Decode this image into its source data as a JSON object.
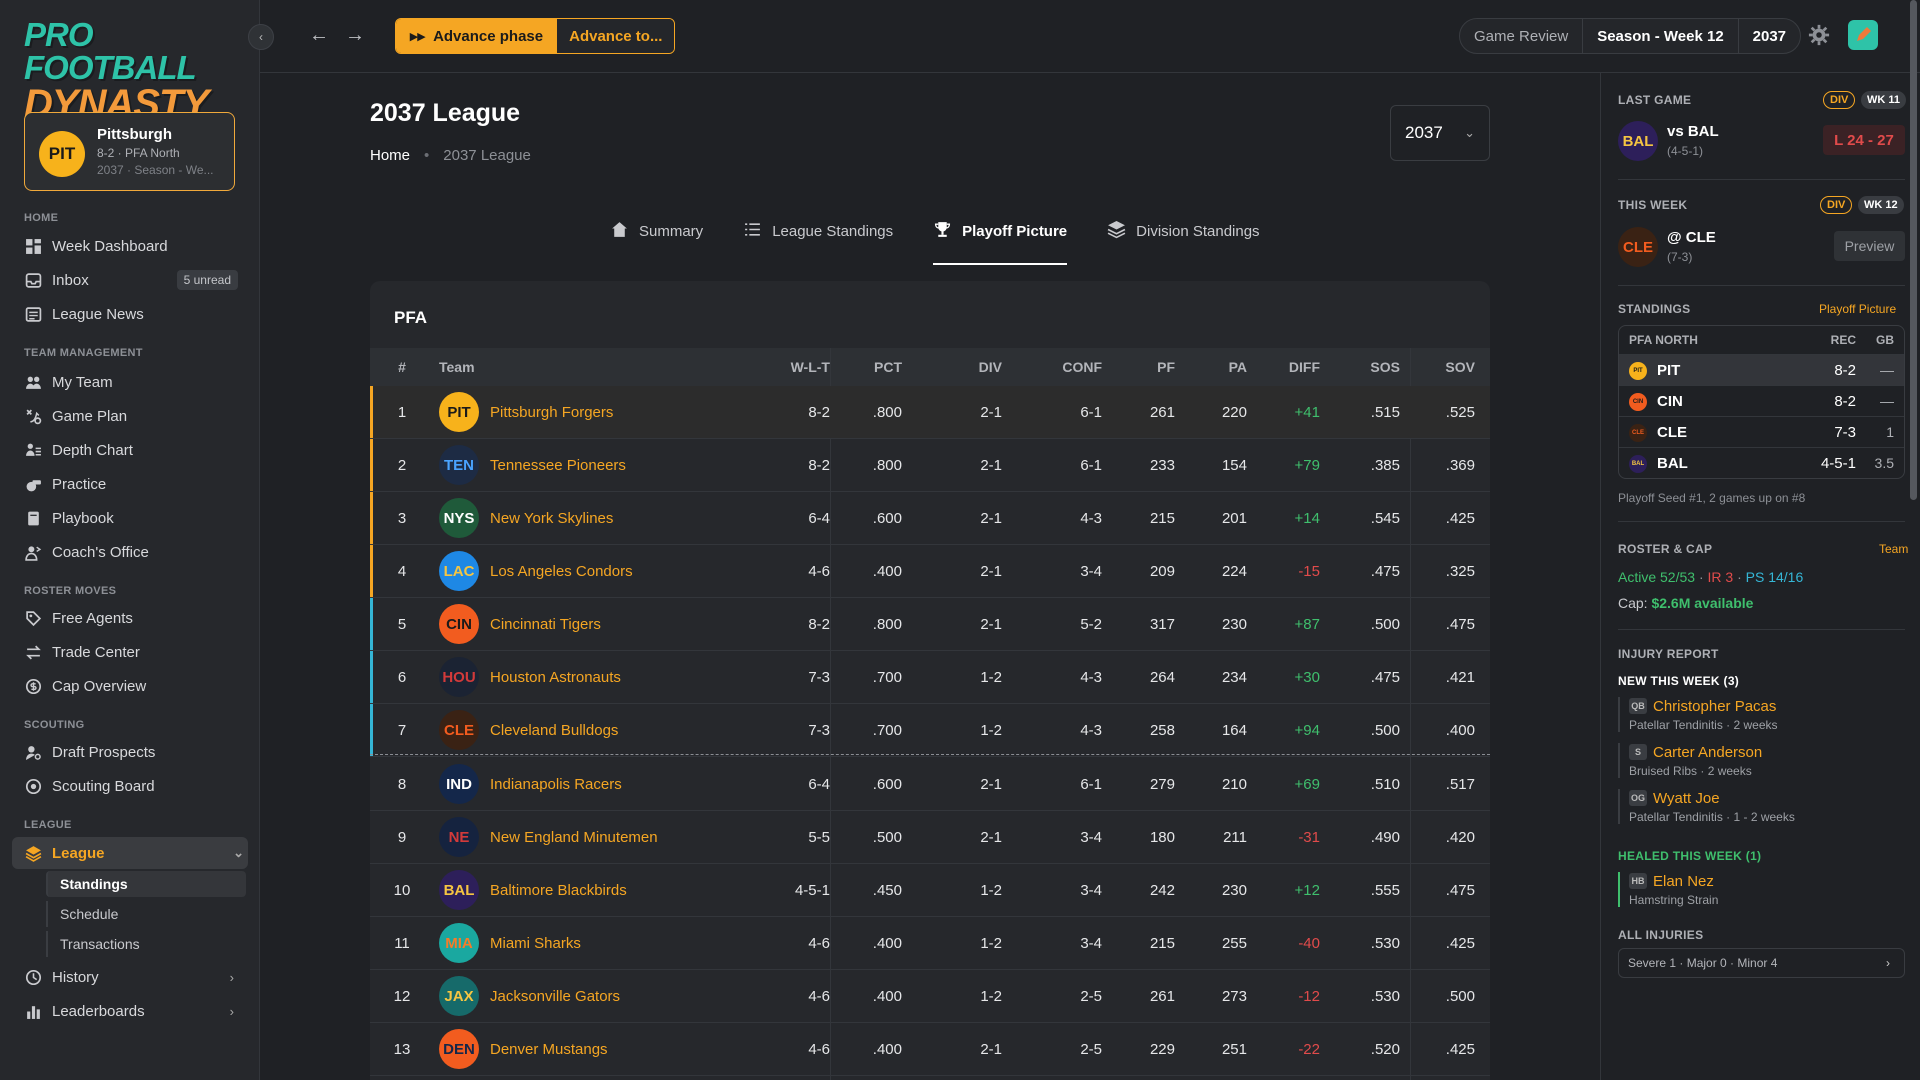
{
  "app": {
    "logo_line1": "PRO FOOTBALL",
    "logo_line2": "DYNASTY",
    "collapse_glyph": "‹",
    "accent": "#f5a623"
  },
  "team_card": {
    "abbr": "PIT",
    "name": "Pittsburgh",
    "record_line": "8-2 · PFA North",
    "season_line": "2037 · Season - We..."
  },
  "sidebar": {
    "sections": {
      "home": "HOME",
      "team_management": "TEAM MANAGEMENT",
      "roster_moves": "ROSTER MOVES",
      "scouting": "SCOUTING",
      "league": "LEAGUE"
    },
    "items": {
      "week_dashboard": "Week Dashboard",
      "inbox": "Inbox",
      "inbox_count": "5 unread",
      "league_news": "League News",
      "my_team": "My Team",
      "game_plan": "Game Plan",
      "depth_chart": "Depth Chart",
      "practice": "Practice",
      "playbook": "Playbook",
      "coachs_office": "Coach's Office",
      "free_agents": "Free Agents",
      "trade_center": "Trade Center",
      "cap_overview": "Cap Overview",
      "draft_prospects": "Draft Prospects",
      "scouting_board": "Scouting Board",
      "league": "League",
      "standings": "Standings",
      "schedule": "Schedule",
      "transactions": "Transactions",
      "history": "History",
      "leaderboards": "Leaderboards"
    }
  },
  "topbar": {
    "back": "←",
    "forward": "→",
    "advance_phase": "Advance phase",
    "advance_to": "Advance to...",
    "game_review": "Game Review",
    "season_week": "Season - Week 12",
    "year": "2037"
  },
  "page": {
    "title": "2037 League",
    "crumb_home": "Home",
    "crumb_sep": "•",
    "crumb_current": "2037 League",
    "year_select": "2037",
    "tabs": {
      "summary": "Summary",
      "league_standings": "League Standings",
      "playoff_picture": "Playoff Picture",
      "division_standings": "Division Standings"
    }
  },
  "table": {
    "conference": "PFA",
    "headers": {
      "rank": "#",
      "team": "Team",
      "wlt": "W-L-T",
      "pct": "PCT",
      "div": "DIV",
      "conf": "CONF",
      "pf": "PF",
      "pa": "PA",
      "diff": "DIFF",
      "sos": "SOS",
      "sov": "SOV"
    },
    "rows": [
      {
        "rank": "1",
        "abbr": "PIT",
        "name": "Pittsburgh Forgers",
        "wlt": "8-2",
        "pct": ".800",
        "div": "2-1",
        "conf": "6-1",
        "pf": "261",
        "pa": "220",
        "diff": "+41",
        "sos": ".515",
        "sov": ".525",
        "logo_bg": "#f7b21b",
        "logo_fg": "#1a1a1a",
        "seed": "division"
      },
      {
        "rank": "2",
        "abbr": "TEN",
        "name": "Tennessee Pioneers",
        "wlt": "8-2",
        "pct": ".800",
        "div": "2-1",
        "conf": "6-1",
        "pf": "233",
        "pa": "154",
        "diff": "+79",
        "sos": ".385",
        "sov": ".369",
        "logo_bg": "#1d2b44",
        "logo_fg": "#4aa3ff",
        "seed": "division"
      },
      {
        "rank": "3",
        "abbr": "NYS",
        "name": "New York Skylines",
        "wlt": "6-4",
        "pct": ".600",
        "div": "2-1",
        "conf": "4-3",
        "pf": "215",
        "pa": "201",
        "diff": "+14",
        "sos": ".545",
        "sov": ".425",
        "logo_bg": "#1f5a3a",
        "logo_fg": "#ffffff",
        "seed": "division"
      },
      {
        "rank": "4",
        "abbr": "LAC",
        "name": "Los Angeles Condors",
        "wlt": "4-6",
        "pct": ".400",
        "div": "2-1",
        "conf": "3-4",
        "pf": "209",
        "pa": "224",
        "diff": "-15",
        "sos": ".475",
        "sov": ".325",
        "logo_bg": "#1e88e5",
        "logo_fg": "#f5c542",
        "seed": "division"
      },
      {
        "rank": "5",
        "abbr": "CIN",
        "name": "Cincinnati Tigers",
        "wlt": "8-2",
        "pct": ".800",
        "div": "2-1",
        "conf": "5-2",
        "pf": "317",
        "pa": "230",
        "diff": "+87",
        "sos": ".500",
        "sov": ".475",
        "logo_bg": "#f25c1f",
        "logo_fg": "#1a1a1a",
        "seed": "wildcard"
      },
      {
        "rank": "6",
        "abbr": "HOU",
        "name": "Houston Astronauts",
        "wlt": "7-3",
        "pct": ".700",
        "div": "1-2",
        "conf": "4-3",
        "pf": "264",
        "pa": "234",
        "diff": "+30",
        "sos": ".475",
        "sov": ".421",
        "logo_bg": "#1b2333",
        "logo_fg": "#d33a3a",
        "seed": "wildcard"
      },
      {
        "rank": "7",
        "abbr": "CLE",
        "name": "Cleveland Bulldogs",
        "wlt": "7-3",
        "pct": ".700",
        "div": "1-2",
        "conf": "4-3",
        "pf": "258",
        "pa": "164",
        "diff": "+94",
        "sos": ".500",
        "sov": ".400",
        "logo_bg": "#3a2214",
        "logo_fg": "#f25c1f",
        "seed": "wildcard"
      },
      {
        "rank": "8",
        "abbr": "IND",
        "name": "Indianapolis Racers",
        "wlt": "6-4",
        "pct": ".600",
        "div": "2-1",
        "conf": "6-1",
        "pf": "279",
        "pa": "210",
        "diff": "+69",
        "sos": ".510",
        "sov": ".517",
        "logo_bg": "#14274a",
        "logo_fg": "#ffffff",
        "seed": "none"
      },
      {
        "rank": "9",
        "abbr": "NE",
        "name": "New England Minutemen",
        "wlt": "5-5",
        "pct": ".500",
        "div": "2-1",
        "conf": "3-4",
        "pf": "180",
        "pa": "211",
        "diff": "-31",
        "sos": ".490",
        "sov": ".420",
        "logo_bg": "#15233f",
        "logo_fg": "#d33a3a",
        "seed": "none"
      },
      {
        "rank": "10",
        "abbr": "BAL",
        "name": "Baltimore Blackbirds",
        "wlt": "4-5-1",
        "pct": ".450",
        "div": "1-2",
        "conf": "3-4",
        "pf": "242",
        "pa": "230",
        "diff": "+12",
        "sos": ".555",
        "sov": ".475",
        "logo_bg": "#2d1f5a",
        "logo_fg": "#f5c542",
        "seed": "none"
      },
      {
        "rank": "11",
        "abbr": "MIA",
        "name": "Miami Sharks",
        "wlt": "4-6",
        "pct": ".400",
        "div": "1-2",
        "conf": "3-4",
        "pf": "215",
        "pa": "255",
        "diff": "-40",
        "sos": ".530",
        "sov": ".425",
        "logo_bg": "#1aa8a0",
        "logo_fg": "#f57c2a",
        "seed": "none"
      },
      {
        "rank": "12",
        "abbr": "JAX",
        "name": "Jacksonville Gators",
        "wlt": "4-6",
        "pct": ".400",
        "div": "1-2",
        "conf": "2-5",
        "pf": "261",
        "pa": "273",
        "diff": "-12",
        "sos": ".530",
        "sov": ".500",
        "logo_bg": "#166a6a",
        "logo_fg": "#f5c542",
        "seed": "none"
      },
      {
        "rank": "13",
        "abbr": "DEN",
        "name": "Denver Mustangs",
        "wlt": "4-6",
        "pct": ".400",
        "div": "2-1",
        "conf": "2-5",
        "pf": "229",
        "pa": "251",
        "diff": "-22",
        "sos": ".520",
        "sov": ".425",
        "logo_bg": "#f25c1f",
        "logo_fg": "#14274a",
        "seed": "none"
      }
    ]
  },
  "right_panel": {
    "last_game": {
      "label": "LAST GAME",
      "div": "DIV",
      "week": "WK 11",
      "abbr": "BAL",
      "opp": "vs BAL",
      "rec": "(4-5-1)",
      "score": "L 24 - 27"
    },
    "this_week": {
      "label": "THIS WEEK",
      "div": "DIV",
      "week": "WK 12",
      "abbr": "CLE",
      "opp": "@ CLE",
      "rec": "(7-3)",
      "preview": "Preview"
    },
    "standings": {
      "label": "STANDINGS",
      "link": "Playoff Picture",
      "division": "PFA NORTH",
      "rec_h": "REC",
      "gb_h": "GB",
      "rows": [
        {
          "abbr": "PIT",
          "rec": "8-2",
          "gb": "—",
          "bg": "#f7b21b",
          "fg": "#1a1a1a"
        },
        {
          "abbr": "CIN",
          "rec": "8-2",
          "gb": "—",
          "bg": "#f25c1f",
          "fg": "#1a1a1a"
        },
        {
          "abbr": "CLE",
          "rec": "7-3",
          "gb": "1",
          "bg": "#3a2214",
          "fg": "#f25c1f"
        },
        {
          "abbr": "BAL",
          "rec": "4-5-1",
          "gb": "3.5",
          "bg": "#2d1f5a",
          "fg": "#f5c542"
        }
      ],
      "note": "Playoff Seed #1, 2 games up on #8"
    },
    "roster": {
      "label": "ROSTER & CAP",
      "link": "Team",
      "active": "Active 52/53",
      "dot1": " · ",
      "ir": "IR 3",
      "dot2": " · ",
      "ps": "PS 14/16",
      "cap_label": "Cap: ",
      "cap_value": "$2.6M available"
    },
    "injury": {
      "label": "INJURY REPORT",
      "new_label": "NEW THIS WEEK (3)",
      "new": [
        {
          "pos": "QB",
          "name": "Christopher Pacas",
          "desc": "Patellar Tendinitis · 2 weeks"
        },
        {
          "pos": "S",
          "name": "Carter Anderson",
          "desc": "Bruised Ribs · 2 weeks"
        },
        {
          "pos": "OG",
          "name": "Wyatt Joe",
          "desc": "Patellar Tendinitis · 1 - 2 weeks"
        }
      ],
      "healed_label": "HEALED THIS WEEK (1)",
      "healed": [
        {
          "pos": "HB",
          "name": "Elan Nez",
          "desc": "Hamstring Strain"
        }
      ],
      "all_label": "ALL INJURIES",
      "all_summary": "Severe 1 · Major 0 · Minor 4"
    }
  }
}
